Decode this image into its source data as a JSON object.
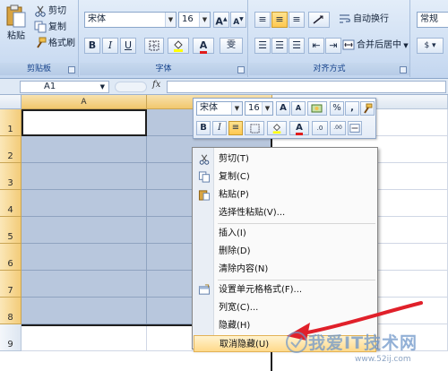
{
  "ribbon": {
    "clipboard": {
      "paste": "粘贴",
      "cut": "剪切",
      "copy": "复制",
      "format_painter": "格式刷",
      "group_label": "剪贴板"
    },
    "font": {
      "font_name": "宋体",
      "font_size": "16",
      "grow": "A",
      "shrink": "A",
      "bold": "B",
      "italic": "I",
      "underline": "U",
      "font_color_glyph": "A",
      "phonetic": "雯",
      "group_label": "字体"
    },
    "alignment": {
      "wrap_text": "自动换行",
      "merge_center": "合并后居中",
      "group_label": "对齐方式"
    },
    "number": {
      "format": "常规"
    }
  },
  "formula_bar": {
    "name_box": "A1",
    "fx": "fx",
    "value": ""
  },
  "grid": {
    "columns": [
      "A",
      ""
    ],
    "rows": [
      "1",
      "2",
      "3",
      "4",
      "5",
      "6",
      "7",
      "8",
      "9"
    ]
  },
  "mini_toolbar": {
    "font_name": "宋体",
    "font_size": "16",
    "grow": "A",
    "shrink": "A",
    "percent": "%",
    "comma": ",",
    "bold": "B",
    "italic": "I",
    "font_color_glyph": "A",
    "inc_decimal": ".0",
    "dec_decimal": ".00"
  },
  "context_menu": {
    "items": [
      {
        "label": "剪切(T)",
        "icon": "scissors-icon"
      },
      {
        "label": "复制(C)",
        "icon": "copy-icon"
      },
      {
        "label": "粘贴(P)",
        "icon": "paste-icon"
      },
      {
        "label": "选择性粘贴(V)...",
        "icon": ""
      },
      {
        "label": "插入(I)",
        "icon": ""
      },
      {
        "label": "删除(D)",
        "icon": ""
      },
      {
        "label": "清除内容(N)",
        "icon": ""
      },
      {
        "label": "设置单元格格式(F)...",
        "icon": "format-cells-icon"
      },
      {
        "label": "列宽(C)...",
        "icon": ""
      },
      {
        "label": "隐藏(H)",
        "icon": ""
      },
      {
        "label": "取消隐藏(U)",
        "icon": ""
      }
    ],
    "highlighted_index": 10
  },
  "watermark": {
    "text": "我爱IT技术网",
    "url": "www.52ij.com"
  },
  "colors": {
    "selection_fill": "#b8c7dd",
    "header_highlight": "#f3cc79",
    "annotation_arrow": "#e0202a",
    "menu_highlight": "#ffd98a"
  }
}
